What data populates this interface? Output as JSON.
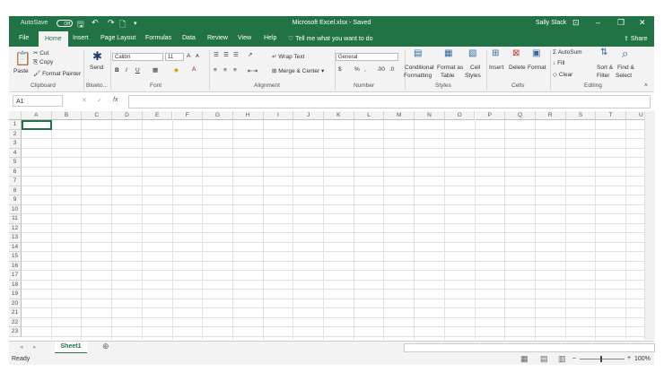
{
  "titlebar": {
    "autosave_label": "AutoSave",
    "autosave_state": "Off",
    "title": "Microsoft Excel.xlsx - Saved",
    "user": "Sally Slack",
    "minimize": "–",
    "restore": "❐",
    "close": "✕",
    "ribbon_display": "⊡",
    "save": "🖫",
    "undo": "↶",
    "redo": "↷",
    "new": "🗋",
    "customize": "▾"
  },
  "tabs": {
    "items": [
      "File",
      "Home",
      "Insert",
      "Page Layout",
      "Formulas",
      "Data",
      "Review",
      "View",
      "Help"
    ],
    "tell_me": "Tell me what you want to do",
    "share": "Share"
  },
  "ribbon": {
    "clipboard": {
      "paste": "Paste",
      "cut": "Cut",
      "copy": "Copy",
      "format_painter": "Format Painter",
      "label": "Clipboard"
    },
    "bluetooth": {
      "send": "Send",
      "label": "Blueto..."
    },
    "font": {
      "name": "Calibri",
      "size": "11",
      "bold": "B",
      "italic": "I",
      "underline": "U",
      "grow": "A",
      "shrink": "A",
      "label": "Font"
    },
    "alignment": {
      "wrap_text": "Wrap Text",
      "merge_center": "Merge & Center",
      "label": "Alignment"
    },
    "number": {
      "format": "General",
      "currency": "$",
      "percent": "%",
      "comma": ",",
      "inc_dec": ".00",
      "dec_dec": ".0",
      "label": "Number"
    },
    "styles": {
      "conditional_1": "Conditional",
      "conditional_2": "Formatting",
      "format_table_1": "Format as",
      "format_table_2": "Table",
      "cell_styles_1": "Cell",
      "cell_styles_2": "Styles",
      "label": "Styles"
    },
    "cells": {
      "insert": "Insert",
      "delete": "Delete",
      "format": "Format",
      "label": "Cells"
    },
    "editing": {
      "autosum": "AutoSum",
      "fill": "Fill",
      "clear": "Clear",
      "sort_1": "Sort &",
      "sort_2": "Filter",
      "find_1": "Find &",
      "find_2": "Select",
      "label": "Editing"
    }
  },
  "formula_bar": {
    "name_box": "A1",
    "cancel": "✕",
    "enter": "✓",
    "fx": "fx"
  },
  "grid": {
    "columns": [
      "A",
      "B",
      "C",
      "D",
      "E",
      "F",
      "G",
      "H",
      "I",
      "J",
      "K",
      "L",
      "M",
      "N",
      "O",
      "P",
      "Q",
      "R",
      "S",
      "T",
      "U"
    ],
    "rows": [
      "1",
      "2",
      "3",
      "4",
      "5",
      "6",
      "7",
      "8",
      "9",
      "10",
      "11",
      "12",
      "13",
      "14",
      "15",
      "16",
      "17",
      "18",
      "19",
      "20",
      "21",
      "22",
      "23"
    ]
  },
  "sheets": {
    "active": "Sheet1",
    "add": "⊕"
  },
  "status": {
    "ready": "Ready",
    "zoom": "100%",
    "minus": "–",
    "plus": "+"
  }
}
